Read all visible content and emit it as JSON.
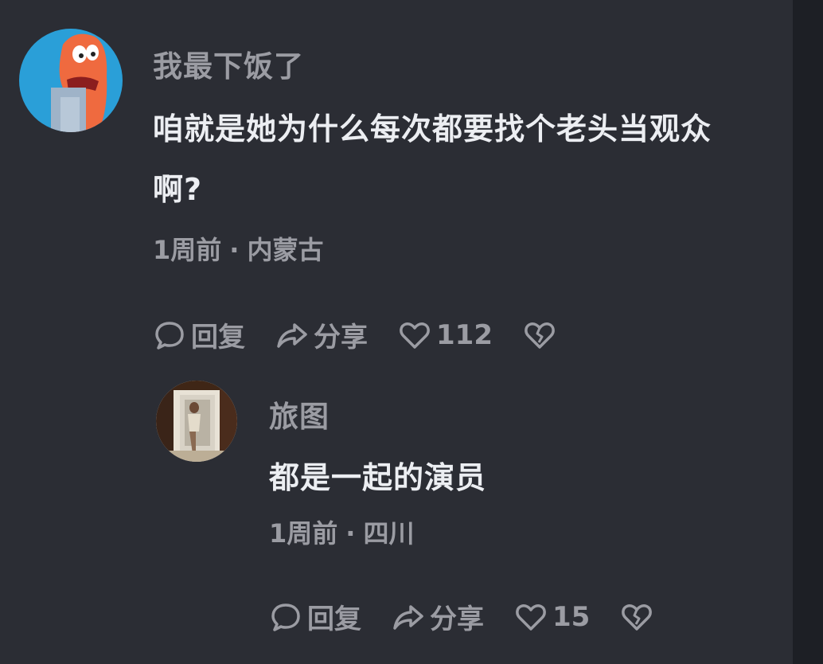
{
  "comments": {
    "main": {
      "username": "我最下饭了",
      "text": "咱就是她为什么每次都要找个老头当观众啊?",
      "time": "1周前",
      "location": "内蒙古",
      "actions": {
        "reply": "回复",
        "share": "分享",
        "likes": "112"
      },
      "avatar": "cartoon-avatar"
    },
    "reply": {
      "username": "旅图",
      "text": "都是一起的演员",
      "time": "1周前",
      "location": "四川",
      "actions": {
        "reply": "回复",
        "share": "分享",
        "likes": "15"
      },
      "avatar": "photo-avatar"
    }
  },
  "separator": "·",
  "icons": {
    "reply": "comment-bubble-icon",
    "share": "share-arrow-icon",
    "like": "heart-icon",
    "dislike": "broken-heart-icon"
  },
  "colors": {
    "background": "#2b2d34",
    "username": "#9b9ca3",
    "text": "#eceef2"
  }
}
